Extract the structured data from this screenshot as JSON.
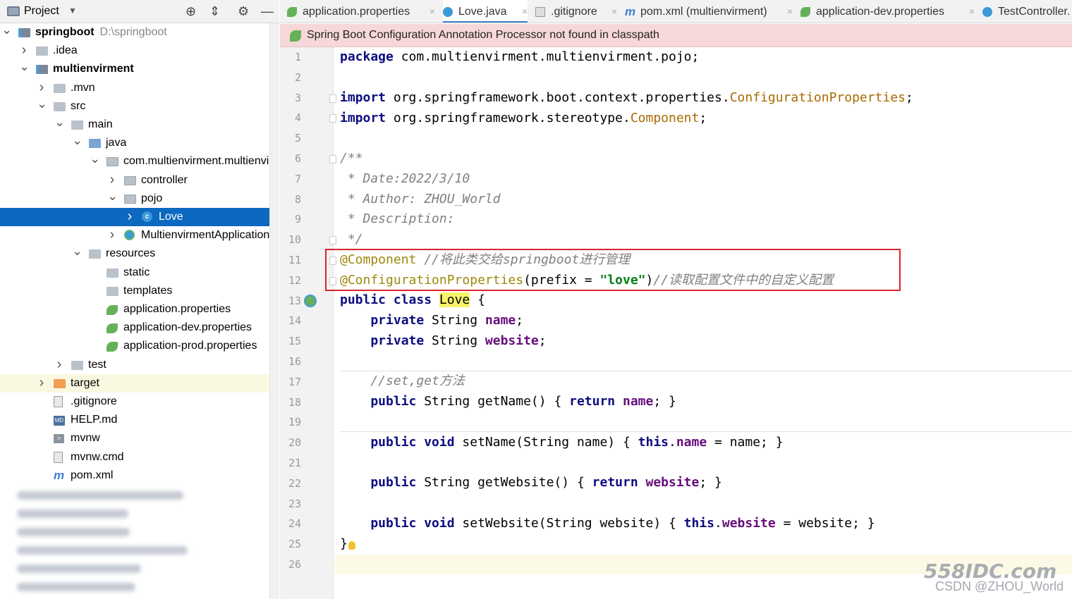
{
  "project_panel": {
    "title": "Project",
    "tree": [
      {
        "label": "springboot",
        "path": "D:\\springboot",
        "icon": "module-icon",
        "bold": true,
        "chev": "v"
      },
      {
        "label": ".idea",
        "icon": "folder-icon",
        "chev": ">"
      },
      {
        "label": "multienvirment",
        "icon": "module-icon",
        "bold": true,
        "chev": "v"
      },
      {
        "label": ".mvn",
        "icon": "folder-icon",
        "chev": ">"
      },
      {
        "label": "src",
        "icon": "folder-icon",
        "chev": "v"
      },
      {
        "label": "main",
        "icon": "folder-icon",
        "chev": "v"
      },
      {
        "label": "java",
        "icon": "source-folder-icon",
        "chev": "v"
      },
      {
        "label": "com.multienvirment.multienvi",
        "icon": "package-icon",
        "chev": "v"
      },
      {
        "label": "controller",
        "icon": "package-icon",
        "chev": ">"
      },
      {
        "label": "pojo",
        "icon": "package-icon",
        "chev": "v"
      },
      {
        "label": "Love",
        "icon": "class-icon",
        "chev": ">",
        "selected": true
      },
      {
        "label": "MultienvirmentApplication",
        "icon": "spring-app-icon",
        "chev": ">"
      },
      {
        "label": "resources",
        "icon": "resource-folder-icon",
        "chev": "v"
      },
      {
        "label": "static",
        "icon": "folder-icon",
        "chev": ""
      },
      {
        "label": "templates",
        "icon": "folder-icon",
        "chev": ""
      },
      {
        "label": "application.properties",
        "icon": "spring-leaf-icon",
        "chev": ""
      },
      {
        "label": "application-dev.properties",
        "icon": "spring-leaf-icon",
        "chev": ""
      },
      {
        "label": "application-prod.properties",
        "icon": "spring-leaf-icon",
        "chev": ""
      },
      {
        "label": "test",
        "icon": "folder-icon",
        "chev": ">"
      },
      {
        "label": "target",
        "icon": "excluded-folder-icon",
        "chev": ">",
        "highlight": true
      },
      {
        "label": ".gitignore",
        "icon": "gitignore-file-icon",
        "chev": ""
      },
      {
        "label": "HELP.md",
        "icon": "markdown-icon",
        "chev": ""
      },
      {
        "label": "mvnw",
        "icon": "terminal-file-icon",
        "chev": ""
      },
      {
        "label": "mvnw.cmd",
        "icon": "text-file-icon",
        "chev": ""
      },
      {
        "label": "pom.xml",
        "icon": "maven-icon",
        "chev": ""
      }
    ]
  },
  "tabs": [
    {
      "label": "application.properties",
      "icon": "spring-leaf-icon"
    },
    {
      "label": "Love.java",
      "icon": "class-icon",
      "active": true
    },
    {
      "label": ".gitignore",
      "icon": "gitignore-file-icon"
    },
    {
      "label": "pom.xml (multienvirment)",
      "icon": "maven-icon"
    },
    {
      "label": "application-dev.properties",
      "icon": "spring-leaf-icon"
    },
    {
      "label": "TestController.",
      "icon": "class-icon"
    }
  ],
  "banner": {
    "text": "Spring Boot Configuration Annotation Processor not found in classpath"
  },
  "editor": {
    "line_numbers": [
      "1",
      "2",
      "3",
      "4",
      "5",
      "6",
      "7",
      "8",
      "9",
      "10",
      "11",
      "12",
      "13",
      "14",
      "15",
      "16",
      "17",
      "18",
      "19",
      "20",
      "21",
      "22",
      "23",
      "24",
      "25",
      "26"
    ],
    "lines": {
      "l1a": "package",
      "l1b": " com.multienvirment.multienvirment.pojo;",
      "l3a": "import",
      "l3b": " org.springframework.boot.context.properties.",
      "l3c": "ConfigurationProperties",
      "l3d": ";",
      "l4a": "import",
      "l4b": " org.springframework.stereotype.",
      "l4c": "Component",
      "l4d": ";",
      "l6": "/**",
      "l7": " * Date:2022/3/10",
      "l8": " * Author: ZHOU_World",
      "l9": " * Description:",
      "l10": " */",
      "l11a": "@Component",
      "l11b": " //将此类交给springboot进行管理",
      "l12a": "@ConfigurationProperties",
      "l12b": "(prefix = ",
      "l12c": "\"love\"",
      "l12d": ")",
      "l12e": "//读取配置文件中的自定义配置",
      "l13a": "public class ",
      "l13b": "Love",
      "l13c": " {",
      "l14a": "    private ",
      "l14b": "String ",
      "l14c": "name",
      "l14d": ";",
      "l15a": "    private ",
      "l15b": "String ",
      "l15c": "website",
      "l15d": ";",
      "l17": "    //set,get方法",
      "l18a": "    public ",
      "l18b": "String getName() { ",
      "l18c": "return ",
      "l18d": "name",
      "l18e": "; }",
      "l20a": "    public void ",
      "l20b": "setName(String name) { ",
      "l20c": "this",
      "l20d": ".",
      "l20e": "name",
      "l20f": " = name; }",
      "l22a": "    public ",
      "l22b": "String getWebsite() { ",
      "l22c": "return ",
      "l22d": "website",
      "l22e": "; }",
      "l24a": "    public void ",
      "l24b": "setWebsite(String website) { ",
      "l24c": "this",
      "l24d": ".",
      "l24e": "website",
      "l24f": " = website; }",
      "l25": "}"
    }
  },
  "watermark": {
    "brand": "558IDC.com",
    "credit": "CSDN @ZHOU_World"
  }
}
